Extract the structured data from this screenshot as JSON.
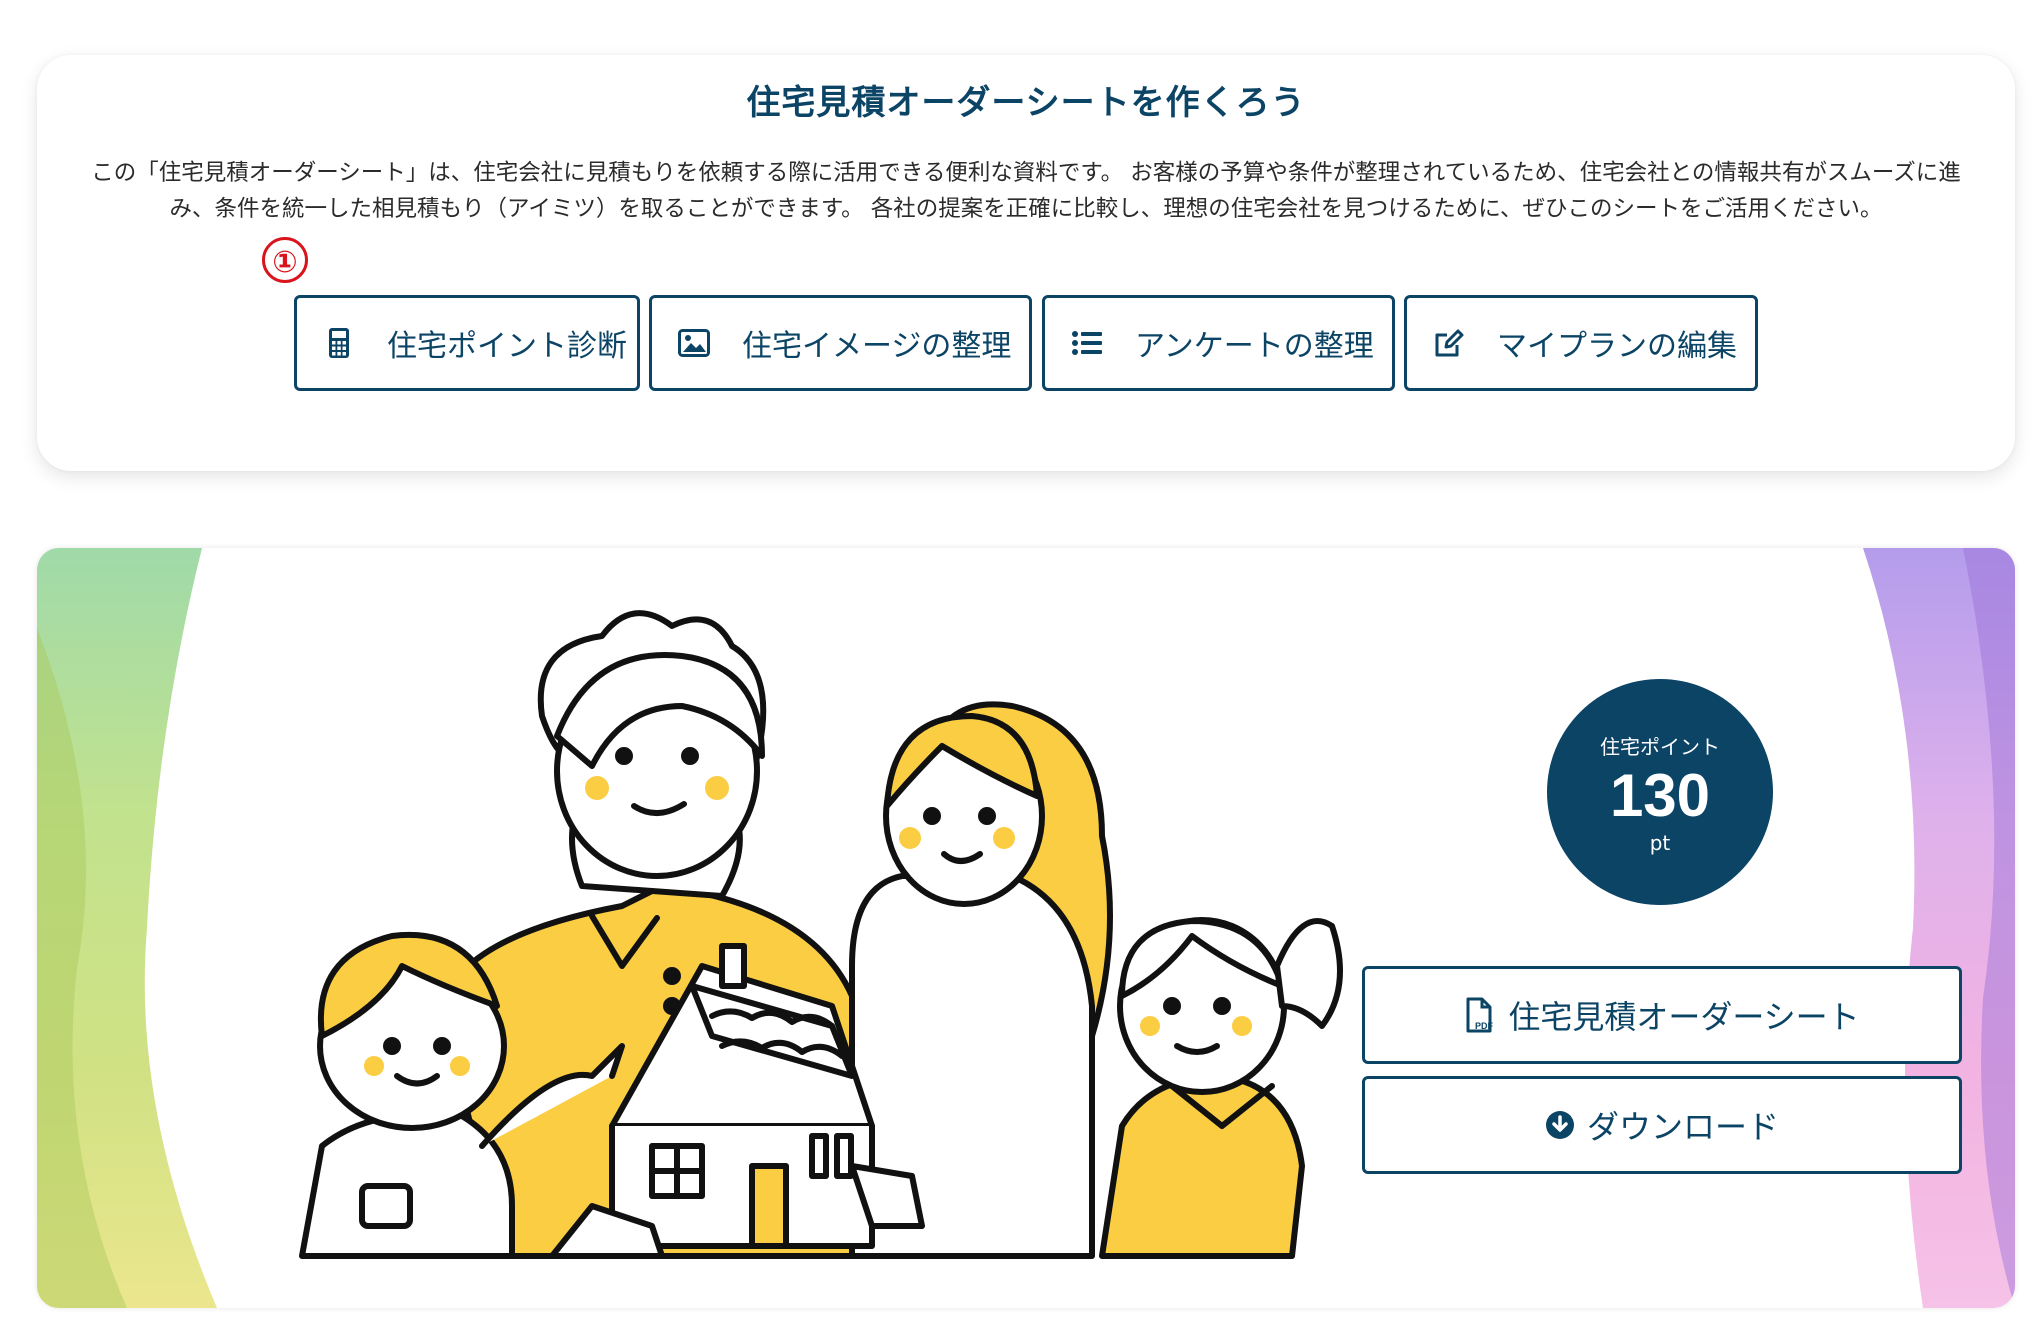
{
  "intro": {
    "title": "住宅見積オーダーシートを作くろう",
    "description": "この「住宅見積オーダーシート」は、住宅会社に見積もりを依頼する際に活用できる便利な資料です。 お客様の予算や条件が整理されているため、住宅会社との情報共有がスムーズに進み、条件を統一した相見積もり（アイミツ）を取ることができます。 各社の提案を正確に比較し、理想の住宅会社を見つけるために、ぜひこのシートをご活用ください。",
    "step_marker": "①",
    "buttons": [
      {
        "label": "住宅ポイント診断",
        "icon": "calculator-icon"
      },
      {
        "label": "住宅イメージの整理",
        "icon": "image-icon"
      },
      {
        "label": "アンケートの整理",
        "icon": "list-icon"
      },
      {
        "label": "マイプランの編集",
        "icon": "edit-icon"
      }
    ]
  },
  "summary": {
    "points_label": "住宅ポイント",
    "points_value": "130",
    "points_unit": "pt",
    "order_sheet_label": "住宅見積オーダーシート",
    "order_sheet_icon": "pdf-file-icon",
    "download_label": "ダウンロード",
    "download_icon": "download-circle-icon"
  },
  "colors": {
    "brand": "#0c4466",
    "marker": "#d8151d",
    "illustration_yellow": "#fbcd42"
  }
}
